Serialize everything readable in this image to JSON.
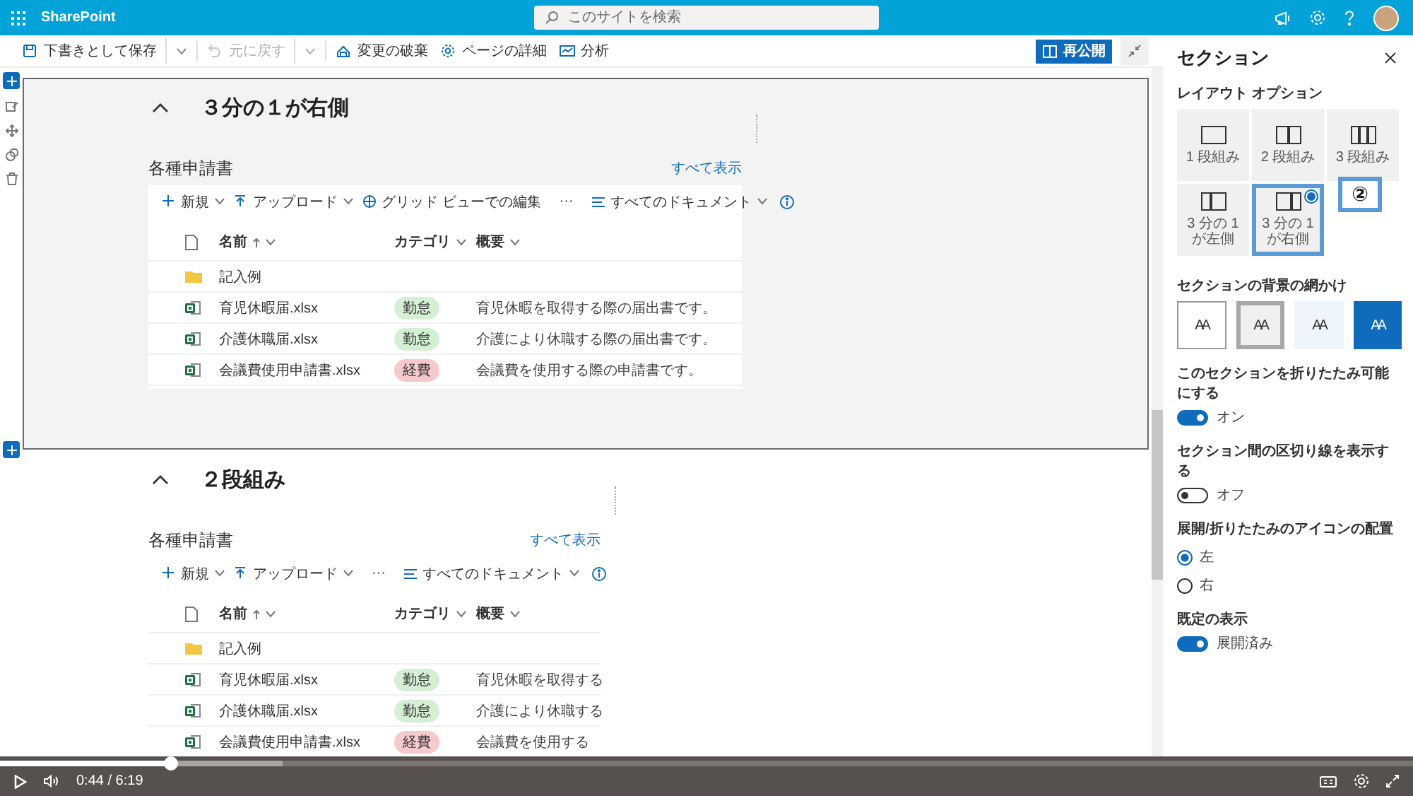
{
  "top_bar": {
    "app_name": "SharePoint",
    "search": {
      "placeholder": "このサイトを検索"
    }
  },
  "command_bar": {
    "items": [
      {
        "kind": "save",
        "label": "下書きとして保存",
        "disabled": false,
        "dropdown": true
      },
      {
        "kind": "undo",
        "label": "元に戻す",
        "disabled": true,
        "dropdown": true
      },
      {
        "kind": "discard",
        "label": "変更の破棄",
        "disabled": false,
        "dropdown": false
      },
      {
        "kind": "details",
        "label": "ページの詳細",
        "disabled": false,
        "dropdown": false
      },
      {
        "kind": "analytics",
        "label": "分析",
        "disabled": false,
        "dropdown": false
      }
    ],
    "publish_button": "再公開"
  },
  "sections": [
    {
      "title": "３分の１が右側",
      "selected": true,
      "kind": "one-third-right",
      "library": {
        "title": "各種申請書",
        "see_all": "すべて表示",
        "commands": [
          {
            "kind": "new",
            "label": "新規",
            "dropdown": true
          },
          {
            "kind": "upload",
            "label": "アップロード",
            "dropdown": true
          },
          {
            "kind": "grid",
            "label": "グリッド ビューでの編集",
            "dropdown": false
          },
          {
            "kind": "more",
            "label": "···",
            "dropdown": false
          }
        ],
        "view": "すべてのドキュメント",
        "columns": [
          {
            "label": "名前",
            "sorted": true
          },
          {
            "label": "カテゴリ",
            "sorted": false
          },
          {
            "label": "概要",
            "sorted": false
          }
        ],
        "rows": [
          {
            "kind": "folder",
            "name": "記入例"
          },
          {
            "kind": "excel",
            "name": "育児休暇届.xlsx",
            "category": {
              "label": "勤怠",
              "color": "#d4efd4"
            },
            "description": "育児休暇を取得する際の届出書です。"
          },
          {
            "kind": "excel",
            "name": "介護休職届.xlsx",
            "category": {
              "label": "勤怠",
              "color": "#d4efd4"
            },
            "description": "介護により休職する際の届出書です。"
          },
          {
            "kind": "excel",
            "name": "会議費使用申請書.xlsx",
            "category": {
              "label": "経費",
              "color": "#f6c9cc"
            },
            "description": "会議費を使用する際の申請書です。"
          }
        ]
      }
    },
    {
      "title": "２段組み",
      "selected": false,
      "kind": "two-column",
      "library": {
        "title": "各種申請書",
        "see_all": "すべて表示",
        "commands": [
          {
            "kind": "new",
            "label": "新規",
            "dropdown": true
          },
          {
            "kind": "upload",
            "label": "アップロード",
            "dropdown": true
          },
          {
            "kind": "more",
            "label": "···",
            "dropdown": false
          }
        ],
        "view": "すべてのドキュメント",
        "columns": [
          {
            "label": "名前",
            "sorted": true
          },
          {
            "label": "カテゴリ",
            "sorted": false
          },
          {
            "label": "概要",
            "sorted": false
          }
        ],
        "rows": [
          {
            "kind": "folder",
            "name": "記入例"
          },
          {
            "kind": "excel",
            "name": "育児休暇届.xlsx",
            "category": {
              "label": "勤怠",
              "color": "#d4efd4"
            },
            "description": "育児休暇を取得する"
          },
          {
            "kind": "excel",
            "name": "介護休職届.xlsx",
            "category": {
              "label": "勤怠",
              "color": "#d4efd4"
            },
            "description": "介護により休職する"
          },
          {
            "kind": "excel",
            "name": "会議費使用申請書.xlsx",
            "category": {
              "label": "経費",
              "color": "#f6c9cc"
            },
            "description": "会議費を使用する"
          }
        ]
      }
    }
  ],
  "panel": {
    "title": "セクション",
    "layout_options": {
      "label": "レイアウト オプション",
      "items": [
        {
          "kind": "one",
          "label": "1 段組み",
          "selected": false
        },
        {
          "kind": "two",
          "label": "2 段組み",
          "selected": false
        },
        {
          "kind": "three",
          "label": "3 段組み",
          "selected": false
        },
        {
          "kind": "third-left",
          "label": "3 分の 1 が左側",
          "selected": false
        },
        {
          "kind": "third-right",
          "label": "3 分の 1 が右側",
          "selected": true
        }
      ]
    },
    "callout": "②",
    "background": {
      "label": "セクションの背景の網かけ",
      "swatches": [
        {
          "kind": "none",
          "label": "AA",
          "selected": false
        },
        {
          "kind": "neutral",
          "label": "AA",
          "selected": true
        },
        {
          "kind": "soft",
          "label": "AA",
          "selected": false
        },
        {
          "kind": "strong",
          "label": "AA",
          "selected": false
        }
      ]
    },
    "settings": [
      {
        "kind": "toggle",
        "label": "このセクションを折りたたみ可能にする",
        "on": true,
        "state_label": "オン"
      },
      {
        "kind": "toggle",
        "label": "セクション間の区切り線を表示する",
        "on": false,
        "state_label": "オフ"
      },
      {
        "kind": "radio-group",
        "label": "展開/折りたたみのアイコンの配置",
        "options": [
          {
            "label": "左",
            "selected": true
          },
          {
            "label": "右",
            "selected": false
          }
        ]
      },
      {
        "kind": "toggle",
        "label": "既定の表示",
        "on": true,
        "state_label": "展開済み"
      }
    ]
  },
  "video_player": {
    "time": "0:44 / 6:19",
    "level": 0.12
  }
}
